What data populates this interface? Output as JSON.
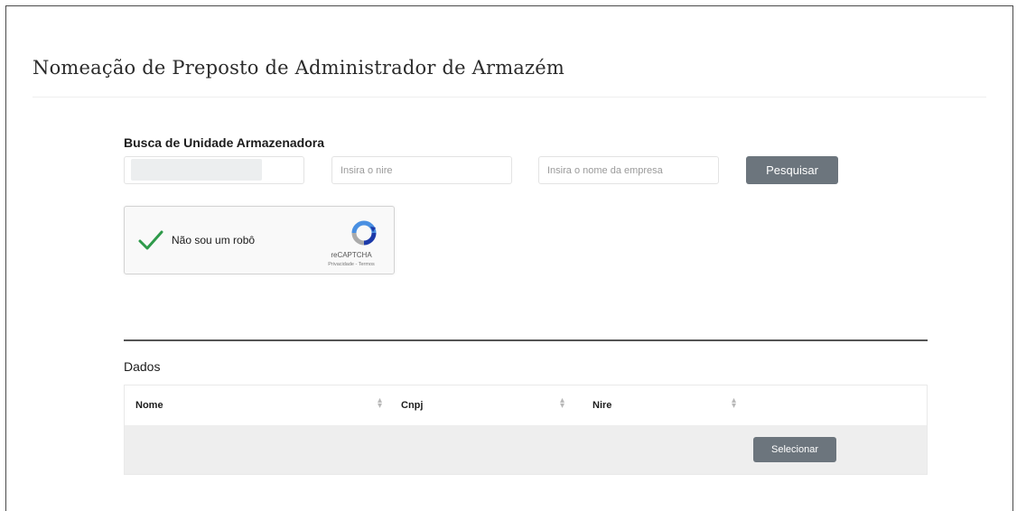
{
  "page": {
    "title": "Nomeação de Preposto de Administrador de Armazém"
  },
  "search": {
    "label": "Busca de Unidade Armazenadora",
    "field1_value": "",
    "nire_placeholder": "Insira o nire",
    "empresa_placeholder": "Insira o nome da empresa",
    "button_label": "Pesquisar"
  },
  "captcha": {
    "label": "Não sou um robô",
    "brand": "reCAPTCHA",
    "links": "Privacidade - Termos",
    "checked": true
  },
  "data": {
    "section_label": "Dados",
    "columns": [
      "Nome",
      "Cnpj",
      "Nire"
    ],
    "rows": [
      {
        "nome": "",
        "cnpj": "",
        "nire": "",
        "action_label": "Selecionar"
      }
    ]
  },
  "colors": {
    "button": "#6c757d",
    "row_bg": "#eeeeee",
    "check": "#2e9a4a"
  }
}
